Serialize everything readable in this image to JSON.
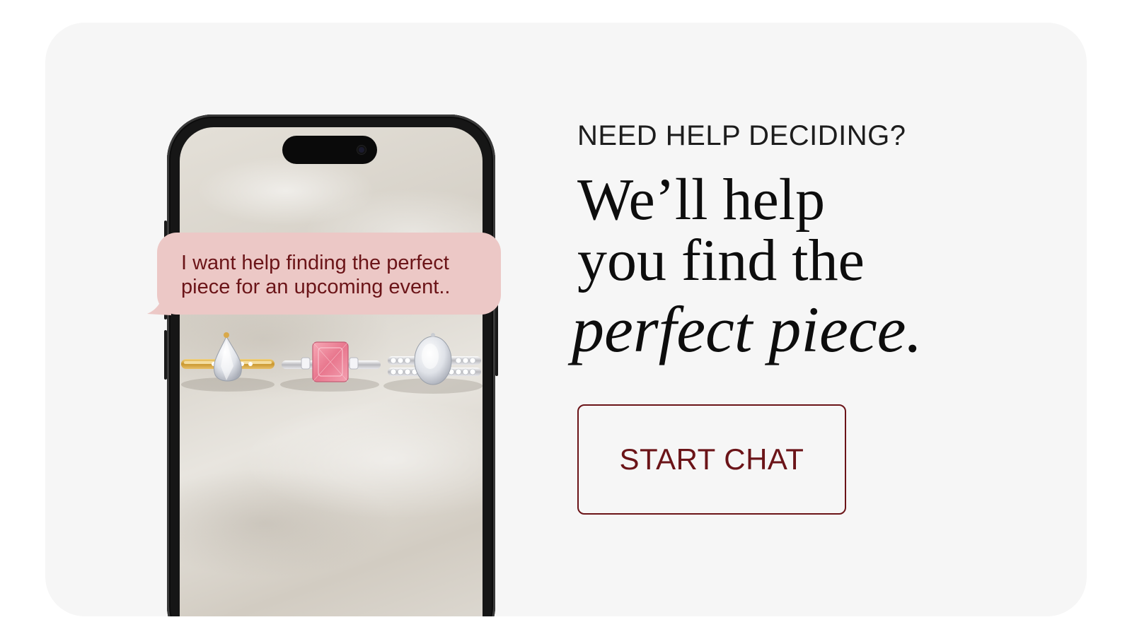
{
  "chat_bubble": {
    "message_line1": "I want help finding the perfect",
    "message_line2": "piece for an upcoming event.."
  },
  "promo": {
    "eyebrow": "NEED HELP DECIDING?",
    "headline_line1": "We’ll help",
    "headline_line2": "you find the",
    "headline_italic": "perfect piece."
  },
  "cta": {
    "label": "START CHAT"
  },
  "colors": {
    "accent": "#6b1418",
    "bubble": "#ecc8c6",
    "card_background": "#f6f6f6"
  },
  "icons": {
    "rings": "rings-photo-icon",
    "camera": "camera-icon"
  }
}
